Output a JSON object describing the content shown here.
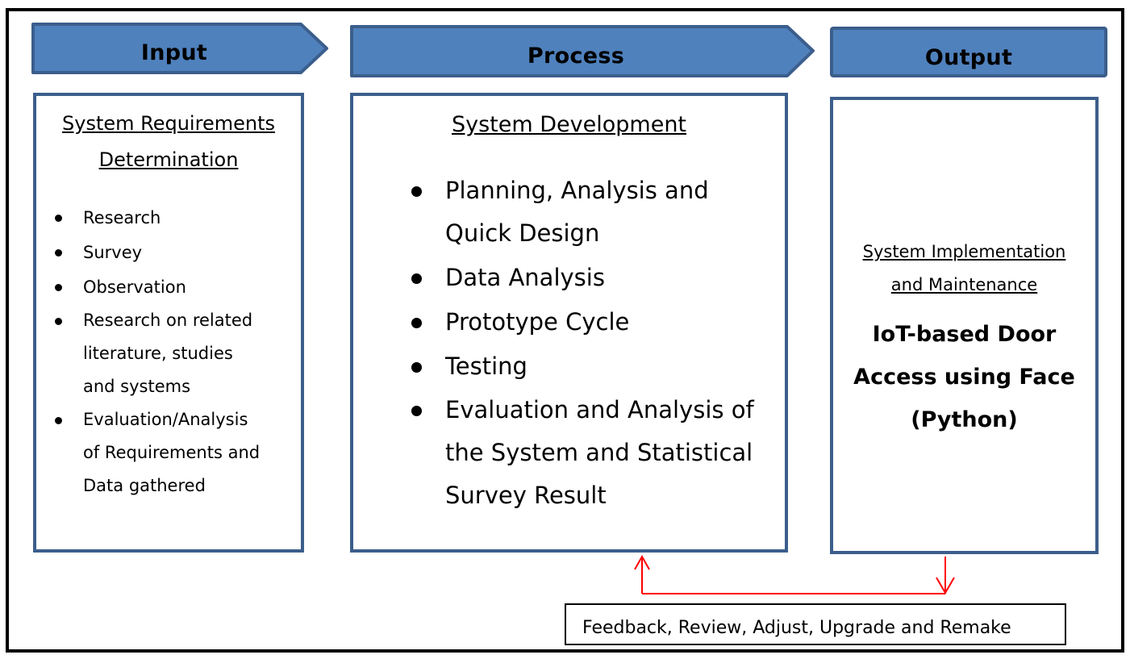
{
  "colors": {
    "header_fill": "#4f81bd",
    "header_border": "#3b5e8c",
    "box_border": "#3b5e8c",
    "feedback_arrow": "#ff0000",
    "frame_border": "#000000"
  },
  "input": {
    "header": "Input",
    "title_line1": "System Requirements",
    "title_line2": "Determination",
    "items": [
      "Research",
      "Survey",
      "Observation",
      "Research on related literature, studies and systems",
      "Evaluation/Analysis of Requirements and Data gathered"
    ],
    "item_lines": [
      [
        "Research"
      ],
      [
        "Survey"
      ],
      [
        "Observation"
      ],
      [
        "Research on related",
        "literature, studies",
        "and systems"
      ],
      [
        "Evaluation/Analysis",
        "of Requirements and",
        "Data gathered"
      ]
    ]
  },
  "process": {
    "header": "Process",
    "title": "System Development",
    "items": [
      "Planning, Analysis and Quick Design",
      "Data Analysis",
      "Prototype Cycle",
      "Testing",
      "Evaluation and Analysis of the System and Statistical Survey Result"
    ],
    "item_lines": [
      [
        "Planning, Analysis and",
        "Quick Design"
      ],
      [
        "Data Analysis"
      ],
      [
        "Prototype Cycle"
      ],
      [
        "Testing"
      ],
      [
        "Evaluation and Analysis of",
        "the System and Statistical",
        "Survey Result"
      ]
    ]
  },
  "output": {
    "header": "Output",
    "subtitle_line1": "System Implementation",
    "subtitle_line2": "and Maintenance",
    "main_line1": "IoT-based Door",
    "main_line2": "Access using Face",
    "main_line3": "(Python)"
  },
  "feedback": {
    "label": "Feedback, Review, Adjust, Upgrade and Remake",
    "arrow_up_icon": "arrow-up-icon",
    "arrow_down_icon": "arrow-down-icon"
  }
}
